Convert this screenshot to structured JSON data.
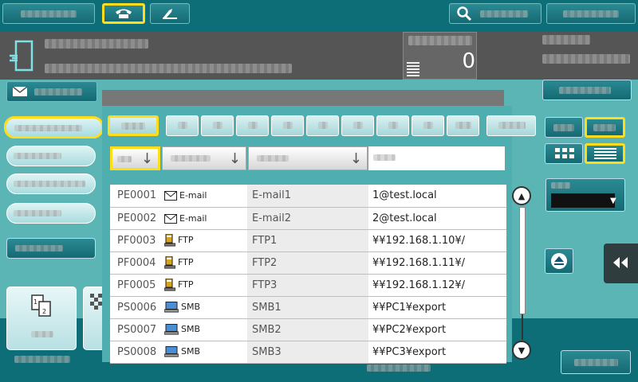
{
  "header": {
    "counter": "0"
  },
  "table": {
    "rows": [
      {
        "id": "PE0001",
        "type": "E-mail",
        "icon": "mail",
        "name": "E-mail1",
        "address": "1@test.local"
      },
      {
        "id": "PE0002",
        "type": "E-mail",
        "icon": "mail",
        "name": "E-mail2",
        "address": "2@test.local"
      },
      {
        "id": "PF0003",
        "type": "FTP",
        "icon": "ftp",
        "name": "FTP1",
        "address": "¥¥192.168.1.10¥/"
      },
      {
        "id": "PF0004",
        "type": "FTP",
        "icon": "ftp",
        "name": "FTP2",
        "address": "¥¥192.168.1.11¥/"
      },
      {
        "id": "PF0005",
        "type": "FTP",
        "icon": "ftp",
        "name": "FTP3",
        "address": "¥¥192.168.1.12¥/"
      },
      {
        "id": "PS0006",
        "type": "SMB",
        "icon": "smb",
        "name": "SMB1",
        "address": "¥¥PC1¥export"
      },
      {
        "id": "PS0007",
        "type": "SMB",
        "icon": "smb",
        "name": "SMB2",
        "address": "¥¥PC2¥export"
      },
      {
        "id": "PS0008",
        "type": "SMB",
        "icon": "smb",
        "name": "SMB3",
        "address": "¥¥PC3¥export"
      }
    ]
  },
  "icons": [
    "phone-icon",
    "fax-icon",
    "search-icon",
    "document-icon",
    "mail-icon",
    "list-counter-icon",
    "scroll-up-icon",
    "scroll-down-icon",
    "collapse-panel-icon",
    "grid-view-icon",
    "list-view-icon",
    "copy-icon"
  ],
  "colors": {
    "accent": "#ffdc1c",
    "frame": "#0d6e78",
    "background": "#5bb5b5"
  }
}
